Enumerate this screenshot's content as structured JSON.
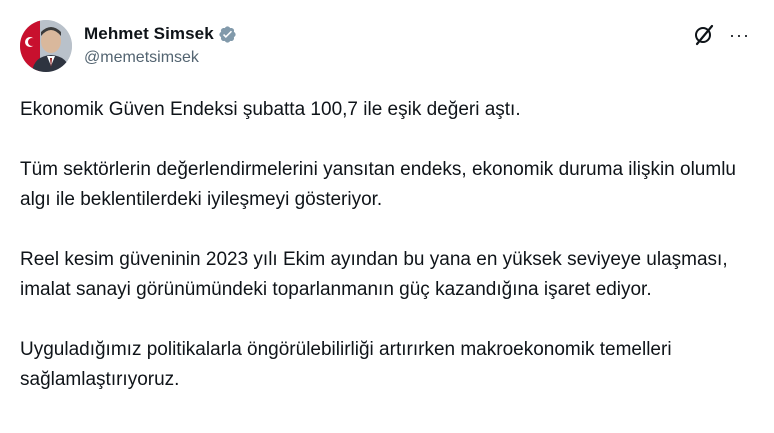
{
  "author": {
    "display_name": "Mehmet Simsek",
    "handle": "@memetsimsek",
    "verified_icon": "verified-badge-icon",
    "avatar": "avatar-photo"
  },
  "actions": {
    "grok_icon": "grok-icon",
    "more_label": "···"
  },
  "tweet": {
    "paragraphs": [
      "Ekonomik Güven Endeksi şubatta 100,7 ile eşik değeri aştı.",
      "Tüm sektörlerin değerlendirmelerini yansıtan endeks, ekonomik duruma ilişkin olumlu algı ile beklentilerdeki iyileşmeyi gösteriyor.",
      "Reel kesim güveninin 2023 yılı Ekim ayından bu yana en yüksek seviyeye ulaşması, imalat sanayi görünümündeki toparlanmanın güç kazandığına işaret ediyor.",
      "Uyguladığımız politikalarla öngörülebilirliği artırırken makroekonomik temelleri sağlamlaştırıyoruz."
    ]
  },
  "colors": {
    "text": "#0f1419",
    "secondary": "#536471",
    "verified": "#829aab"
  }
}
